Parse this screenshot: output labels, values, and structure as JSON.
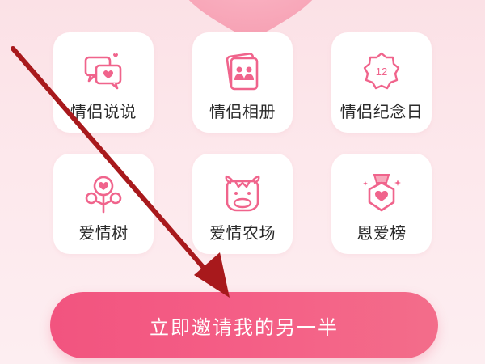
{
  "features": [
    {
      "label": "情侣说说",
      "icon": "chat-bubbles-icon"
    },
    {
      "label": "情侣相册",
      "icon": "photo-album-icon"
    },
    {
      "label": "情侣纪念日",
      "icon": "anniversary-badge-icon",
      "badge_number": "12"
    },
    {
      "label": "爱情树",
      "icon": "love-tree-icon"
    },
    {
      "label": "爱情农场",
      "icon": "cow-farm-icon"
    },
    {
      "label": "恩爱榜",
      "icon": "ranking-medal-icon"
    }
  ],
  "invite_button": {
    "label": "立即邀请我的另一半"
  },
  "annotation": {
    "icon": "red-arrow-icon"
  },
  "colors": {
    "background": "#fbe1e6",
    "icon_pink": "#f0648c",
    "button": "#f2547f",
    "arrow": "#a8191c"
  }
}
